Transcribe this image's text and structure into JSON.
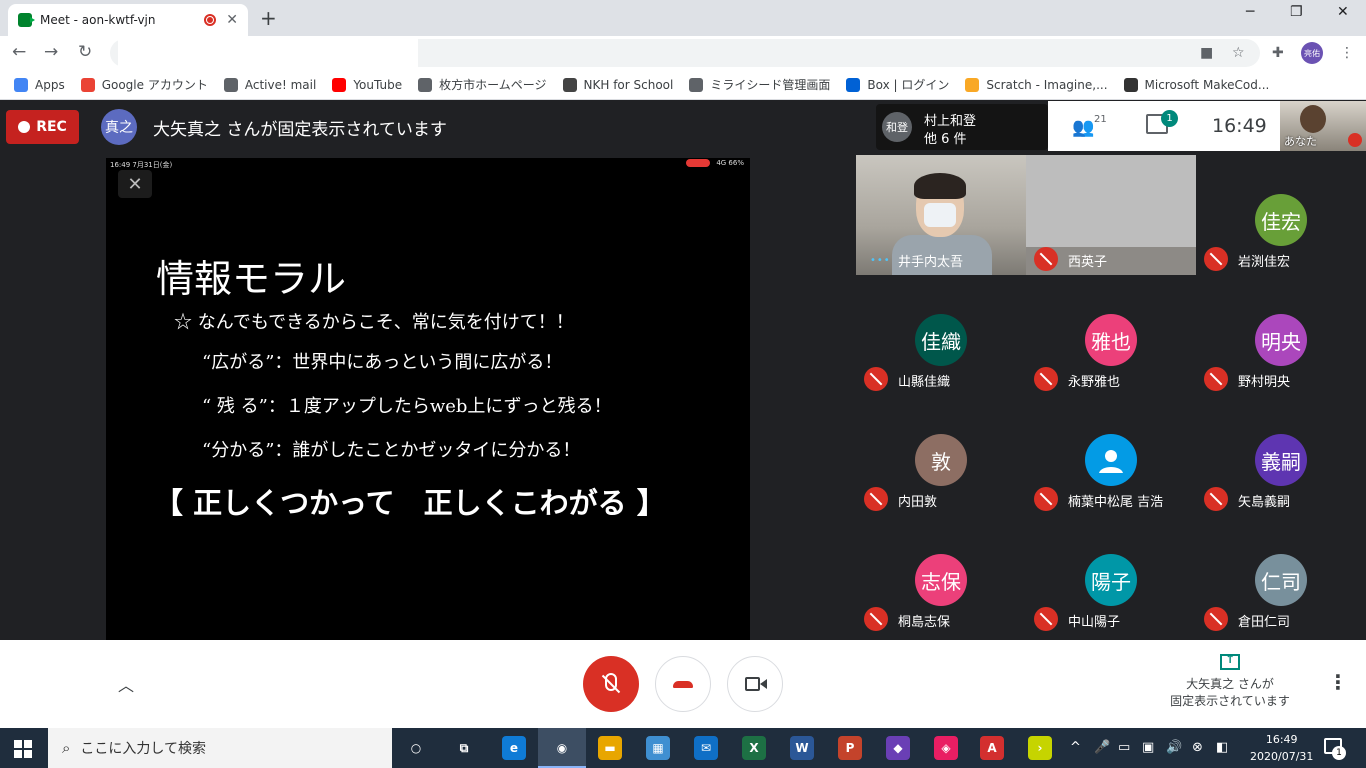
{
  "browser": {
    "tab_title": "Meet - aon-kwtf-vjn",
    "close_glyph": "✕",
    "new_tab_glyph": "+",
    "win_min": "─",
    "win_max": "❐",
    "win_close": "✕",
    "back": "←",
    "forward": "→",
    "reload": "↻",
    "profile_initials": "亮佑"
  },
  "bookmarks": [
    {
      "label": "Apps",
      "color": "#4285f4"
    },
    {
      "label": "Google アカウント",
      "color": "#ea4335"
    },
    {
      "label": "Active! mail",
      "color": "#5f6368"
    },
    {
      "label": "YouTube",
      "color": "#ff0000"
    },
    {
      "label": "枚方市ホームページ",
      "color": "#5f6368"
    },
    {
      "label": "NKH for School",
      "color": "#444444"
    },
    {
      "label": "ミライシード管理画面",
      "color": "#5f6368"
    },
    {
      "label": "Box | ログイン",
      "color": "#0061d5"
    },
    {
      "label": "Scratch - Imagine,...",
      "color": "#f9a825"
    },
    {
      "label": "Microsoft MakeCod...",
      "color": "#333333"
    }
  ],
  "meet": {
    "rec_label": "REC",
    "pinned_avatar": "真之",
    "pinned_text": "大矢真之 さんが固定表示されています",
    "caller_avatar": "和登",
    "caller_name": "村上和登",
    "caller_more": "他 6 件",
    "people_count": "21",
    "chat_badge": "1",
    "clock": "16:49",
    "self_label": "あなた"
  },
  "presentation": {
    "status_left": "16:49  7月31日(金)",
    "status_right": "4G 66%",
    "close_glyph": "✕",
    "title": "情報モラル",
    "line1": "☆ なんでもできるからこそ、常に気を付けて！！",
    "line2": "“広がる”：世界中にあっという間に広がる！",
    "line3": "“ 残 る”：１度アップしたらweb上にずっと残る！",
    "line4": "“分かる”：誰がしたことかゼッタイに分かる！",
    "big": "【 正しくつかって　正しくこわがる 】"
  },
  "participants": [
    {
      "name": "井手内太吾",
      "avatar": "",
      "color": "",
      "kind": "video"
    },
    {
      "name": "西英子",
      "avatar": "",
      "color": "",
      "kind": "gray"
    },
    {
      "name": "岩渕佳宏",
      "avatar": "佳宏",
      "color": "#689f38",
      "kind": "avatar"
    },
    {
      "name": "山縣佳織",
      "avatar": "佳織",
      "color": "#00574b",
      "kind": "avatar"
    },
    {
      "name": "永野雅也",
      "avatar": "雅也",
      "color": "#ec407a",
      "kind": "avatar"
    },
    {
      "name": "野村明央",
      "avatar": "明央",
      "color": "#ab47bc",
      "kind": "avatar"
    },
    {
      "name": "内田敦",
      "avatar": "敦",
      "color": "#8d6e63",
      "kind": "avatar"
    },
    {
      "name": "楠葉中松尾 吉浩",
      "avatar": "",
      "color": "#039be5",
      "kind": "person"
    },
    {
      "name": "矢島義嗣",
      "avatar": "義嗣",
      "color": "#5e35b1",
      "kind": "avatar"
    },
    {
      "name": "桐島志保",
      "avatar": "志保",
      "color": "#ec407a",
      "kind": "avatar"
    },
    {
      "name": "中山陽子",
      "avatar": "陽子",
      "color": "#0097a7",
      "kind": "avatar"
    },
    {
      "name": "倉田仁司",
      "avatar": "仁司",
      "color": "#78909c",
      "kind": "avatar"
    }
  ],
  "controls": {
    "up_glyph": "︿",
    "present_line1": "大矢真之 さんが",
    "present_line2": "固定表示されています",
    "kebab": "⋮"
  },
  "taskbar": {
    "search_placeholder": "ここに入力して検索",
    "time": "16:49",
    "date": "2020/07/31",
    "notif_count": "1",
    "apps": [
      {
        "label": "○",
        "color": "transparent"
      },
      {
        "label": "⧉",
        "color": "transparent"
      },
      {
        "label": "e",
        "color": "#0f7bd6"
      },
      {
        "label": "◉",
        "color": "transparent"
      },
      {
        "label": "▬",
        "color": "#e8a600"
      },
      {
        "label": "▦",
        "color": "#3f8fd1"
      },
      {
        "label": "✉",
        "color": "#0f6fc6"
      },
      {
        "label": "X",
        "color": "#1d7044"
      },
      {
        "label": "W",
        "color": "#2b5797"
      },
      {
        "label": "P",
        "color": "#c4432b"
      },
      {
        "label": "◆",
        "color": "#6a3fb5"
      },
      {
        "label": "◈",
        "color": "#e91e63"
      },
      {
        "label": "A",
        "color": "#d32f2f"
      },
      {
        "label": "›",
        "color": "#c6d400"
      }
    ]
  }
}
